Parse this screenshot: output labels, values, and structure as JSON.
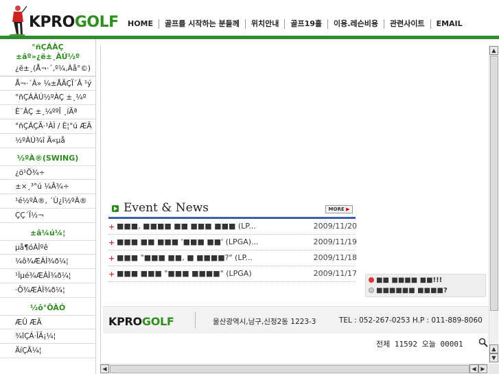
{
  "header": {
    "logo_k": "KPRO",
    "logo_g": "GOLF",
    "nav": [
      "HOME",
      "골프를 시작하는 분들께",
      "위치안내",
      "골프19홀",
      "이용.레슨비용",
      "관련사이트",
      "EMAIL"
    ]
  },
  "sidebar": {
    "group1_title": "°ñÇÁÀÇ ±âº»¿ë±¸ÀÚ½º",
    "group1_items": [
      "¿ë±¸(Å¬·´,º¼,Àå°©)",
      "Å¬·´À» ¼±ÅÃÇÏ´Â ¹ý",
      "°ñÇÁÀÚ½ºÀÇ ±¸¼º",
      "È¨ÀÇ ±¸¼ººÎ ¸íÄª",
      "°ñÇÁÇÃ·¹ÀÌ / È¦°ú ÆÄ",
      "½ºÀÚ¾î Ä«µå"
    ],
    "group2_title": "½ºÀ®(SWING)",
    "group2_items": [
      "¿ö¹Ö¾÷",
      "±×¸³°ú ¼Â¾÷",
      "¹é½ºÀ®, ´Ù¿î½ºÀ®",
      "ÇÇ´Ï½¬"
    ],
    "group3_title": "±â¼ú¼¦",
    "group3_items": [
      "µå¶óÀÌºê",
      "¼ô¾ÆÀÌ¾ð¼¦",
      "¹Ìµé¾ÆÀÌ¾ð¼¦",
      "·Õ¾ÆÀÌ¾ð¼¦"
    ],
    "group4_title": "½ô°ÔÀÓ",
    "group4_items": [
      "ÆÛ ÆÃ",
      "¾îÇÁ·ÎÄ¡¼¦",
      "ÄíÇÃ¼¦"
    ]
  },
  "news": {
    "title": "Event & News",
    "more_label": "MORE",
    "items": [
      {
        "text": "■■■, ■■■■ ■■ ■■■ ■■■ (LP...",
        "date": "2009/11/20"
      },
      {
        "text": "■■■ ■■ ■■■ '■■■ ■■' (LPGA)...",
        "date": "2009/11/19"
      },
      {
        "text": "■■■ \"■■■ ■■, ■ ■■■■?\" (LP...",
        "date": "2009/11/18"
      },
      {
        "text": "■■■ ■■■ \"■■■ ■■■■\" (LPGA)",
        "date": "2009/11/17"
      }
    ]
  },
  "notice": {
    "line1": "■■ ■■■■ ■■!!!",
    "line2": "■■■■■■ ■■■■?"
  },
  "footer": {
    "logo_k": "KPRO",
    "logo_g": "GOLF",
    "address": "울산광역시,남구,신정2동 1223-3",
    "tel": "TEL : 052-267-0253  H.P  : 011-889-8060"
  },
  "counter": {
    "text": "전체 11592 오늘 00001"
  },
  "colors": {
    "brand_green": "#2f8f1f",
    "news_line": "#3a5fb0"
  }
}
